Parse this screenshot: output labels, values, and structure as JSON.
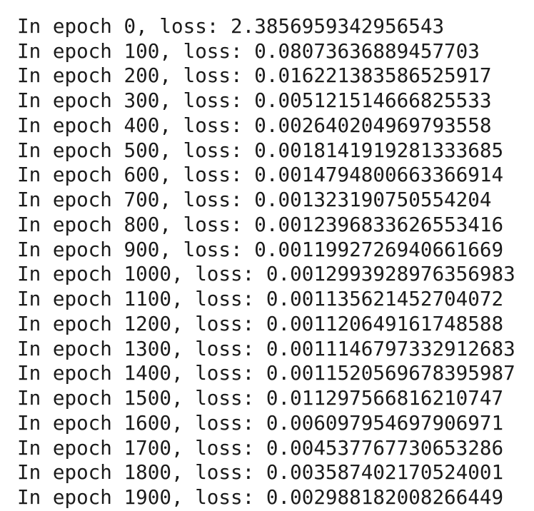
{
  "terminal": {
    "cut_line": "                                  ",
    "lines": [
      "In epoch 0, loss: 2.3856959342956543",
      "In epoch 100, loss: 0.08073636889457703",
      "In epoch 200, loss: 0.016221383586525917",
      "In epoch 300, loss: 0.005121514666825533",
      "In epoch 400, loss: 0.002640204969793558",
      "In epoch 500, loss: 0.0018141919281333685",
      "In epoch 600, loss: 0.0014794800663366914",
      "In epoch 700, loss: 0.001323190750554204",
      "In epoch 800, loss: 0.0012396833626553416",
      "In epoch 900, loss: 0.0011992726940661669",
      "In epoch 1000, loss: 0.0012993928976356983",
      "In epoch 1100, loss: 0.001135621452704072",
      "In epoch 1200, loss: 0.001120649161748588",
      "In epoch 1300, loss: 0.0011146797332912683",
      "In epoch 1400, loss: 0.0011520569678395987",
      "In epoch 1500, loss: 0.011297566816210747",
      "In epoch 1600, loss: 0.006097954697906971",
      "In epoch 1700, loss: 0.004537767730653286",
      "In epoch 1800, loss: 0.003587402170524001",
      "In epoch 1900, loss: 0.002988182008266449"
    ]
  }
}
